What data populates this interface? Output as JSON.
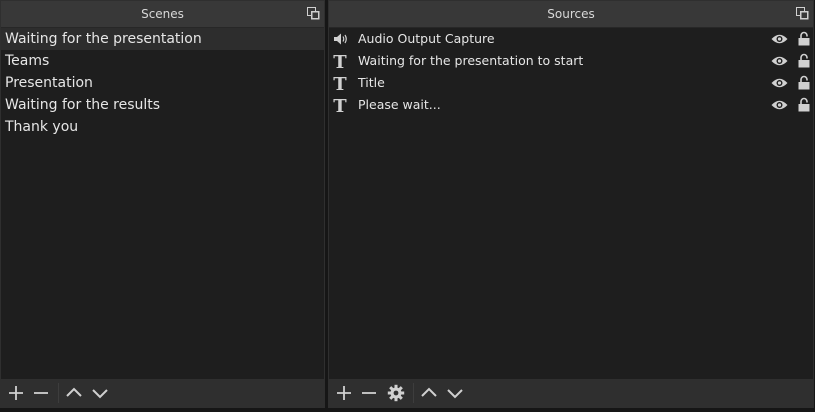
{
  "scenes": {
    "title": "Scenes",
    "items": [
      {
        "label": "Waiting for the presentation",
        "selected": true
      },
      {
        "label": "Teams",
        "selected": false
      },
      {
        "label": "Presentation",
        "selected": false
      },
      {
        "label": "Waiting for the results",
        "selected": false
      },
      {
        "label": "Thank you",
        "selected": false
      }
    ],
    "toolbar": [
      "add-icon",
      "remove-icon",
      "move-up-icon",
      "move-down-icon"
    ]
  },
  "sources": {
    "title": "Sources",
    "items": [
      {
        "label": "Audio Output Capture",
        "icon": "speaker-icon",
        "visible": true,
        "locked": false
      },
      {
        "label": "Waiting for the presentation to start",
        "icon": "text-icon",
        "visible": true,
        "locked": false
      },
      {
        "label": "Title",
        "icon": "text-icon",
        "visible": true,
        "locked": false
      },
      {
        "label": "Please wait...",
        "icon": "text-icon",
        "visible": true,
        "locked": false
      }
    ],
    "toolbar": [
      "add-icon",
      "remove-icon",
      "gear-icon",
      "move-up-icon",
      "move-down-icon"
    ]
  },
  "colors": {
    "panel_bg": "#272727",
    "list_bg": "#1e1e1e",
    "header_bg": "#383838",
    "text": "#e6e6e6",
    "icon": "#d0d0d0"
  }
}
